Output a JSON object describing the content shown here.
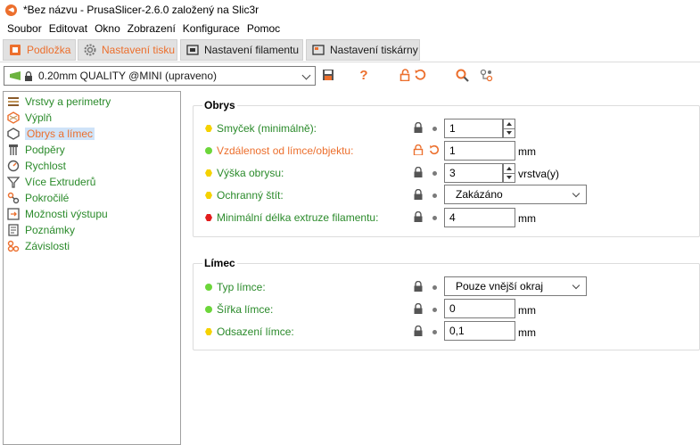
{
  "window": {
    "title": "*Bez názvu - PrusaSlicer-2.6.0 založený na Slic3r"
  },
  "menu": [
    "Soubor",
    "Editovat",
    "Okno",
    "Zobrazení",
    "Konfigurace",
    "Pomoc"
  ],
  "tabs": [
    {
      "label": "Podložka",
      "icon": "plater-icon"
    },
    {
      "label": "Nastavení tisku",
      "icon": "gear-icon",
      "active": true
    },
    {
      "label": "Nastavení filamentu",
      "icon": "spool-icon"
    },
    {
      "label": "Nastavení tiskárny",
      "icon": "printer-icon"
    }
  ],
  "toolbar": {
    "preset": "0.20mm QUALITY @MINI (upraveno)",
    "icons": [
      "save-icon",
      "question-icon",
      "lock-open-icon",
      "undo-icon",
      "search-icon",
      "compare-icon"
    ]
  },
  "tree": [
    {
      "label": "Vrstvy a perimetry",
      "icon": "layers-icon"
    },
    {
      "label": "Výplň",
      "icon": "infill-icon"
    },
    {
      "label": "Obrys a límec",
      "icon": "skirt-icon",
      "selected": true
    },
    {
      "label": "Podpěry",
      "icon": "support-icon"
    },
    {
      "label": "Rychlost",
      "icon": "speed-icon"
    },
    {
      "label": "Více Extruderů",
      "icon": "funnel-icon"
    },
    {
      "label": "Pokročilé",
      "icon": "wrench-icon"
    },
    {
      "label": "Možnosti výstupu",
      "icon": "output-icon"
    },
    {
      "label": "Poznámky",
      "icon": "notes-icon"
    },
    {
      "label": "Závislosti",
      "icon": "dependencies-icon"
    }
  ],
  "groups": {
    "obrys": {
      "title": "Obrys",
      "rows": [
        {
          "label": "Smyček (minimálně):",
          "value": "1",
          "unit": ""
        },
        {
          "label": "Vzdálenost od límce/objektu:",
          "value": "1",
          "unit": "mm"
        },
        {
          "label": "Výška obrysu:",
          "value": "3",
          "unit": "vrstva(y)"
        },
        {
          "label": "Ochranný štít:",
          "value": "Zakázáno",
          "unit": ""
        },
        {
          "label": "Minimální délka extruze filamentu:",
          "value": "4",
          "unit": "mm"
        }
      ]
    },
    "limec": {
      "title": "Límec",
      "rows": [
        {
          "label": "Typ límce:",
          "value": "Pouze vnější okraj",
          "unit": ""
        },
        {
          "label": "Šířka límce:",
          "value": "0",
          "unit": "mm"
        },
        {
          "label": "Odsazení límce:",
          "value": "0,1",
          "unit": "mm"
        }
      ]
    }
  },
  "colors": {
    "accent": "#ec6f2d",
    "label_green": "#2a8a2a",
    "bullet_green": "#6cd63a",
    "bullet_yellow": "#f5d200",
    "bullet_red": "#e21d1d"
  }
}
